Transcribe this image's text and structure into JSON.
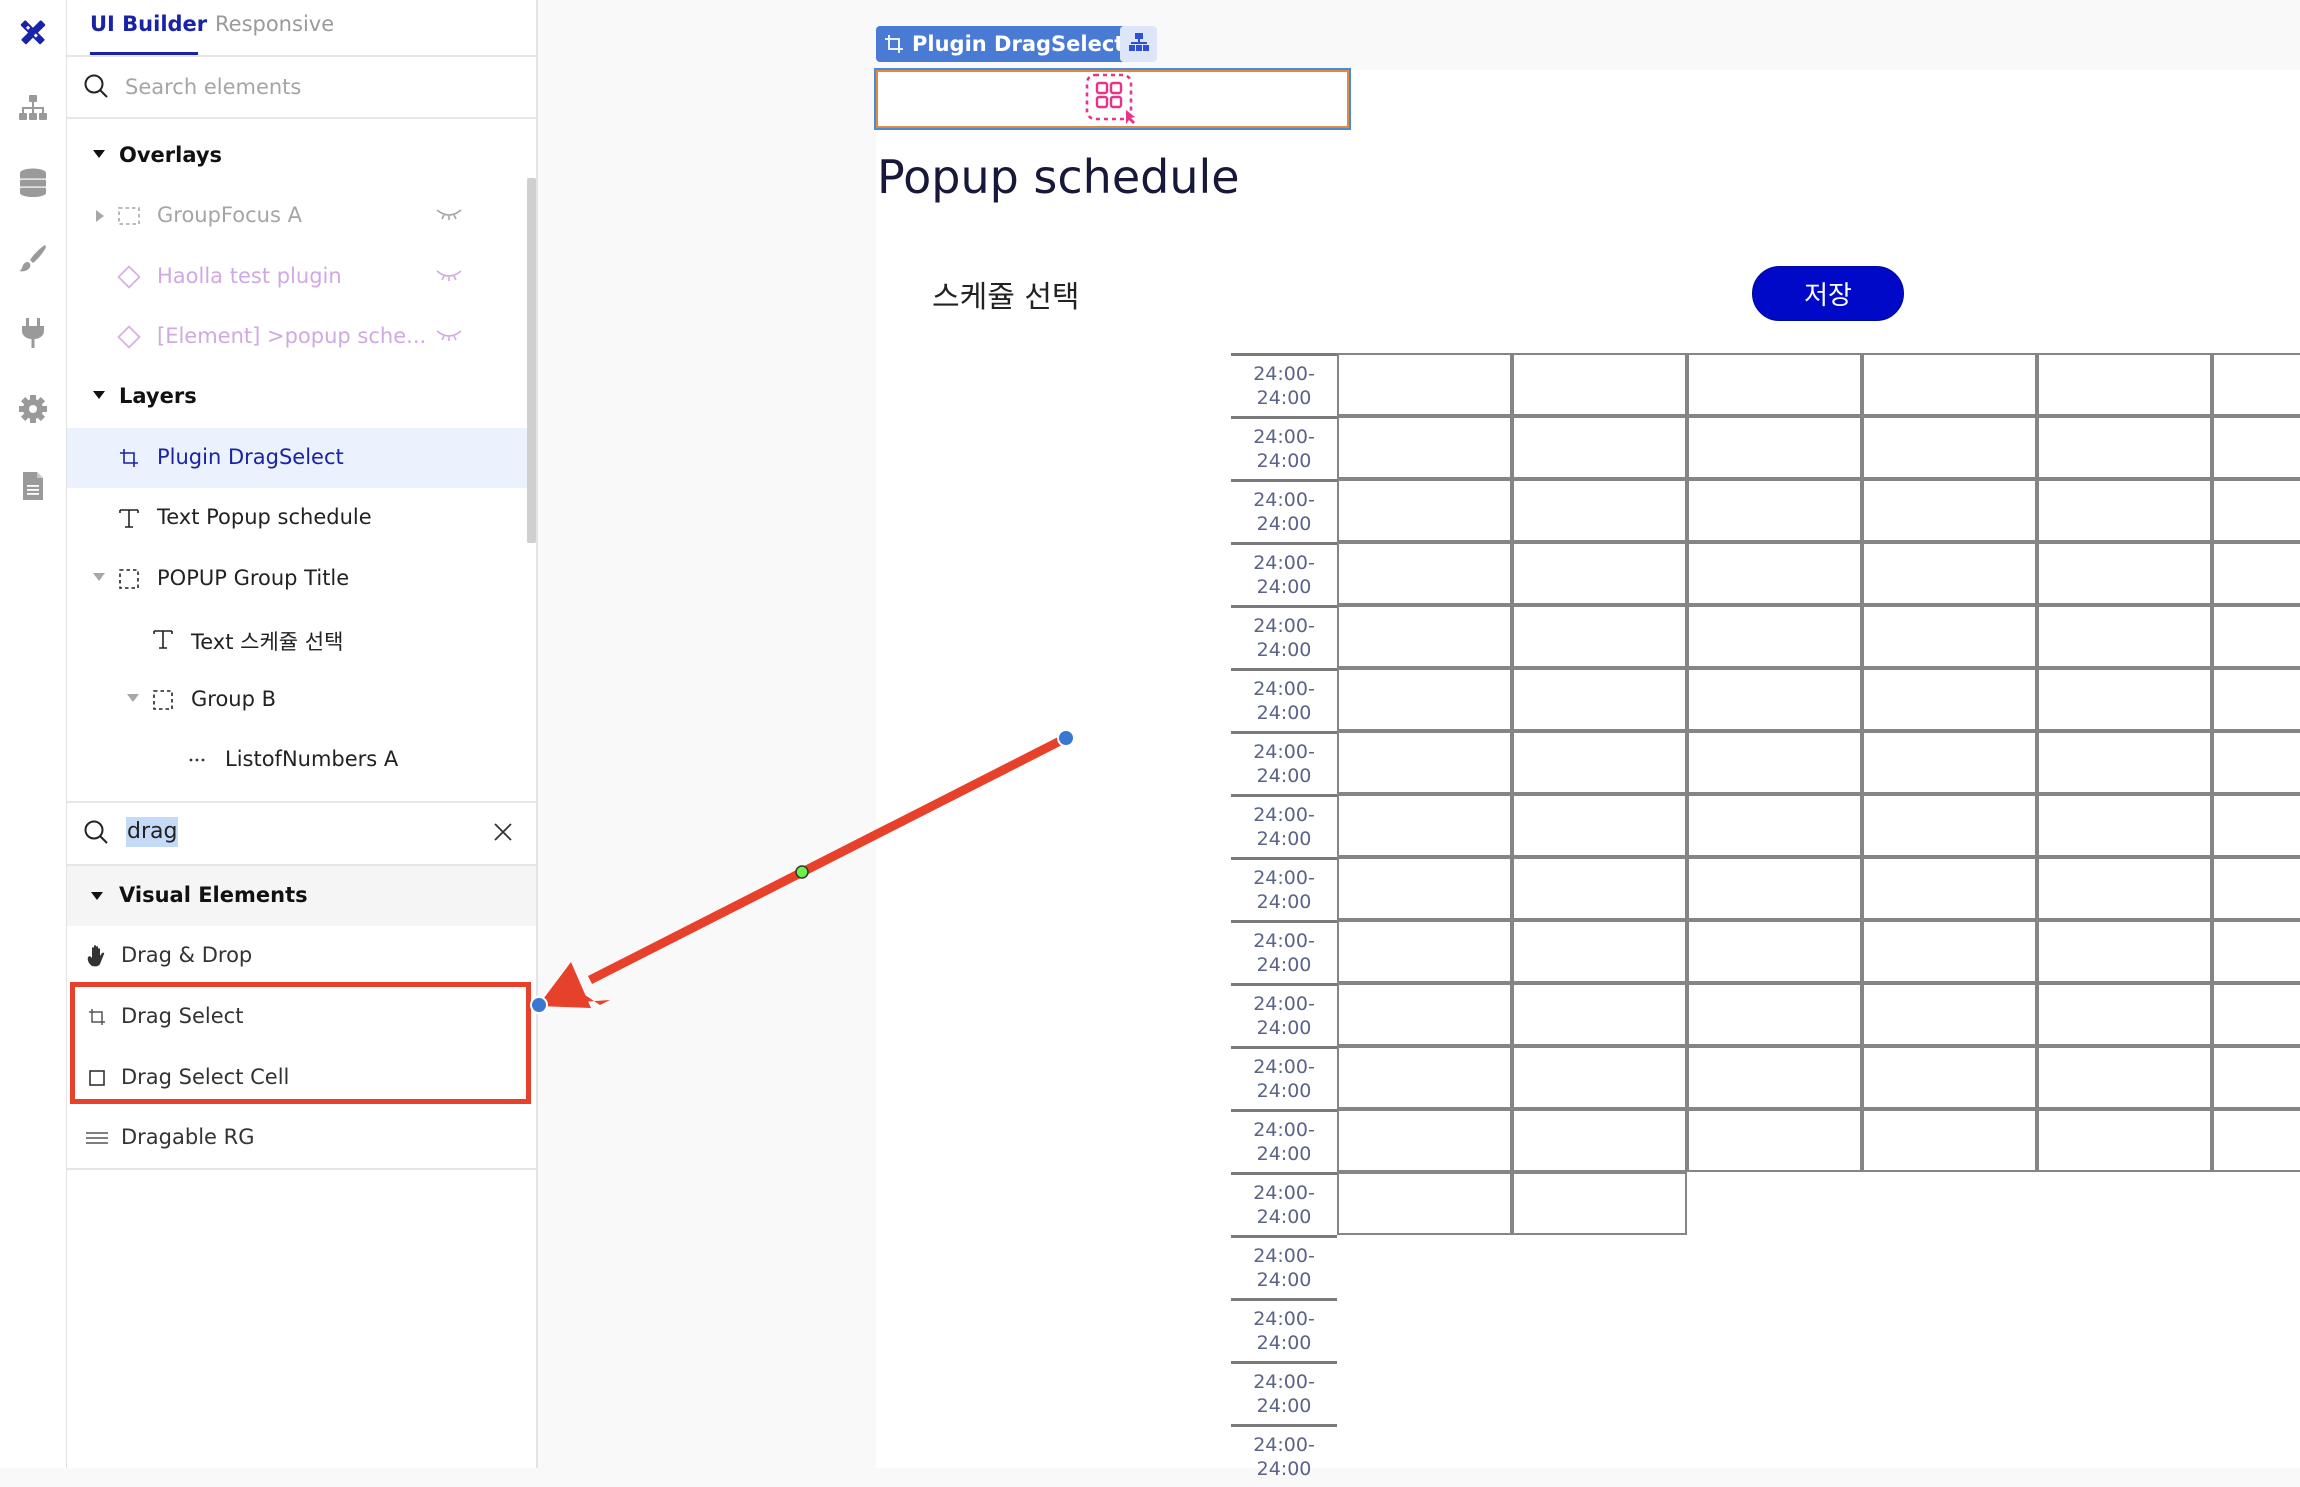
{
  "rail": {
    "items": [
      {
        "name": "design-icon",
        "active": true
      },
      {
        "name": "hierarchy-icon",
        "active": false
      },
      {
        "name": "database-icon",
        "active": false
      },
      {
        "name": "brush-icon",
        "active": false
      },
      {
        "name": "plug-icon",
        "active": false
      },
      {
        "name": "gear-icon",
        "active": false
      },
      {
        "name": "document-icon",
        "active": false
      }
    ]
  },
  "panel": {
    "tabs": [
      {
        "label": "UI Builder",
        "active": true
      },
      {
        "label": "Responsive",
        "active": false
      }
    ],
    "element_search": {
      "placeholder": "Search elements",
      "value": ""
    },
    "overlays": {
      "header": "Overlays",
      "items": [
        {
          "label": "GroupFocus A",
          "icon": "group-icon",
          "hidden": true,
          "style": "muted"
        },
        {
          "label": "Haolla test plugin",
          "icon": "diamond-icon",
          "hidden": true,
          "style": "purple"
        },
        {
          "label": "[Element] >popup sche...",
          "icon": "diamond-icon",
          "hidden": true,
          "style": "purple"
        }
      ]
    },
    "layers": {
      "header": "Layers",
      "items": [
        {
          "label": "Plugin DragSelect",
          "icon": "crop-icon",
          "selected": true
        },
        {
          "label": "Text Popup schedule",
          "icon": "text-icon"
        },
        {
          "label": "POPUP Group Title",
          "icon": "group-icon",
          "expanded": true
        },
        {
          "label": "Text 스케쥴 선택",
          "icon": "text-icon"
        },
        {
          "label": "Group B",
          "icon": "group-icon",
          "expanded": true
        },
        {
          "label": "ListofNumbers A",
          "icon": "ellipsis-icon"
        }
      ]
    },
    "palette_search": {
      "value": "drag"
    },
    "visual_elements": {
      "header": "Visual Elements",
      "items": [
        {
          "label": "Drag & Drop",
          "icon": "hand-icon"
        },
        {
          "label": "Drag Select",
          "icon": "crop-icon",
          "highlighted": true
        },
        {
          "label": "Drag Select Cell",
          "icon": "square-icon",
          "highlighted": true
        },
        {
          "label": "Dragable RG",
          "icon": "lines-icon"
        }
      ]
    }
  },
  "canvas": {
    "selected_tag": "Plugin DragSelect",
    "page_title": "Popup schedule",
    "subtitle": "스케쥴 선택",
    "save_button": "저장",
    "grid": {
      "row_labels": [
        "24:00-\n24:00",
        "24:00-\n24:00",
        "24:00-\n24:00",
        "24:00-\n24:00",
        "24:00-\n24:00",
        "24:00-\n24:00",
        "24:00-\n24:00",
        "24:00-\n24:00",
        "24:00-\n24:00",
        "24:00-\n24:00",
        "24:00-\n24:00",
        "24:00-\n24:00",
        "24:00-\n24:00",
        "24:00-\n24:00",
        "24:00-\n24:00",
        "24:00-\n24:00",
        "24:00-\n24:00",
        "24:00-\n24:00"
      ],
      "full_rows": 13,
      "visible_columns": 6,
      "partial_row_cells": 2
    }
  },
  "annotation": {
    "color": "#e8412b",
    "target": "Drag Select / Drag Select Cell"
  },
  "colors": {
    "accent": "#1a22a8",
    "tag_blue": "#4a7bd4",
    "save_button": "#0009c8",
    "plugin_pink": "#e8338a",
    "overlay_purple": "#d6b4e6"
  }
}
